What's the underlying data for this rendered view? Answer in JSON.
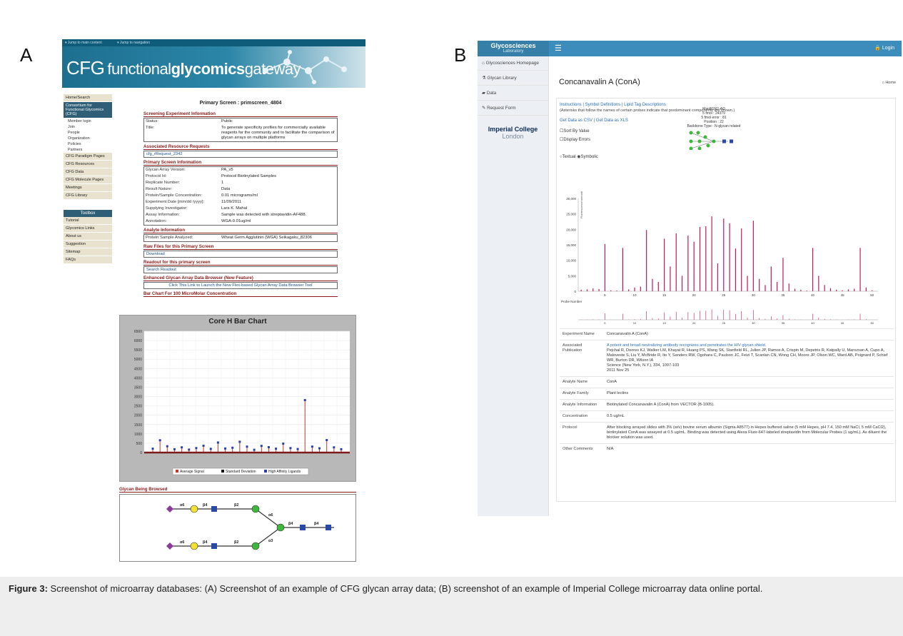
{
  "panel_labels": {
    "a": "A",
    "b": "B"
  },
  "cfg": {
    "skip_links": [
      "Jump to main content",
      "Jump to navigation"
    ],
    "logo_prefix": "CFG",
    "logo_text_1": "functional",
    "logo_text_2": "glycomics",
    "logo_text_3": "gateway",
    "nav": [
      {
        "label": "Home/Search",
        "dark": false
      },
      {
        "label": "Consortium for Functional Glycomics (CFG)",
        "dark": true
      }
    ],
    "subnav": [
      "Member login",
      "Join",
      "People",
      "Organization",
      "Policies",
      "Partners"
    ],
    "nav2": [
      "CFG Paradigm Pages",
      "CFG Resources",
      "CFG Data",
      "CFG Molecule Pages",
      "Meetings",
      "CFG Library"
    ],
    "toolbox_title": "Toolbox",
    "toolbox": [
      "Tutorial",
      "Glycomics Links",
      "About us",
      "Suggestion",
      "Sitemap",
      "FAQs"
    ],
    "page_title": "Primary Screen : primscreen_4804",
    "sec_screening": "Screening Experiment Information",
    "screening": [
      {
        "k": "Status:",
        "v": "Public"
      },
      {
        "k": "Title:",
        "v": "To generate specificity profiles for commercially available reagents for the community and to facilitate the comparison of glycan arrays on multiple platforms"
      }
    ],
    "sec_resource": "Associated Resource Requests",
    "resource": "cfg_rRequest_2342",
    "sec_primary": "Primary Screen Information",
    "primary": [
      {
        "k": "Glycan Array Version:",
        "v": "PA_v5",
        "link": false
      },
      {
        "k": "Protocol Id:",
        "v": "Protocol Biotinylated Samples",
        "link": true
      },
      {
        "k": "Replicate Number:",
        "v": "1",
        "link": false
      },
      {
        "k": "Result Nature:",
        "v": "Data",
        "link": false
      },
      {
        "k": "Protein/Sample Concentration:",
        "v": "0.01 micrograms/ml",
        "link": false
      },
      {
        "k": "Experiment Date [mm/dd /yyyy]:",
        "v": "11/09/2011",
        "link": false
      },
      {
        "k": "Supplying Investigator:",
        "v": "Lara K. Mahal",
        "link": true
      },
      {
        "k": "Assay Information:",
        "v": "Sample was detected with streptavidin-AF488.",
        "link": false
      },
      {
        "k": "Annotation:",
        "v": "WGA-0.01ug/ml",
        "link": false
      }
    ],
    "sec_analyte": "Analyte Information",
    "analyte_k": "Protein Sample Analyzed:",
    "analyte_v": "Wheat Germ Agglutinin (WGA) Seikagaku_82306",
    "sec_raw": "Raw Files for this Primary Screen",
    "raw": "Download",
    "sec_readout": "Readout for this primary screen",
    "readout": "Search Readout",
    "sec_enhanced": "Enhanced Glycan Array Data Browser (New Feature)",
    "enhanced": "Click This Link to Launch the New Flex-based Glycan Array Data Browser Tool",
    "sec_bar": "Bar Chart For 100 MicroMolar Concentration",
    "sec_glycan": "Glycan Being Browsed",
    "glycan_links": [
      "α6",
      "β4",
      "β2",
      "α6",
      "β4",
      "β4",
      "α6",
      "β4",
      "β2",
      "α3"
    ]
  },
  "chart_data": [
    {
      "type": "bar",
      "title": "Core H Bar Chart",
      "ylim": [
        0,
        6500
      ],
      "yticks": [
        0,
        500,
        1000,
        1500,
        2000,
        2500,
        3000,
        3500,
        4000,
        4500,
        5000,
        5500,
        6000,
        6500
      ],
      "series": [
        {
          "name": "Average Signal",
          "values": [
            150,
            600,
            280,
            120,
            220,
            100,
            180,
            310,
            140,
            480,
            160,
            200,
            520,
            260,
            90,
            300,
            230,
            150,
            420,
            180,
            130,
            2750,
            260,
            170,
            610,
            220,
            120
          ]
        },
        {
          "name": "Standard Deviation"
        },
        {
          "name": "High Affinity Ligands"
        }
      ],
      "grid": true,
      "legend": "bottom"
    },
    {
      "type": "bar",
      "ylabel": "Fluorescence intensity",
      "xlabel": "Probe Number",
      "ylim": [
        0,
        30000
      ],
      "yticks": [
        "0",
        "5,000",
        "10,000",
        "15,000",
        "20,000",
        "25,000",
        "30,000"
      ],
      "xticks": [
        5,
        10,
        15,
        20,
        25,
        30,
        35,
        40,
        45,
        50
      ],
      "x": [
        1,
        2,
        3,
        4,
        5,
        6,
        7,
        8,
        9,
        10,
        11,
        12,
        13,
        14,
        15,
        16,
        17,
        18,
        19,
        20,
        21,
        22,
        23,
        24,
        25,
        26,
        27,
        28,
        29,
        30,
        31,
        32,
        33,
        34,
        35,
        36,
        37,
        38,
        39,
        40,
        41,
        42,
        43,
        44,
        45,
        46,
        47,
        48,
        49,
        50
      ],
      "values": [
        500,
        600,
        900,
        700,
        15300,
        300,
        200,
        14000,
        600,
        1200,
        1500,
        19800,
        4000,
        3000,
        17000,
        8000,
        18700,
        5000,
        18000,
        16000,
        20800,
        21000,
        24200,
        9000,
        23500,
        22000,
        13800,
        20300,
        5000,
        22800,
        4000,
        2000,
        8000,
        3000,
        10800,
        2500,
        800,
        500,
        200,
        14000,
        5000,
        2000,
        1000,
        500,
        300,
        600,
        800,
        14000,
        1200,
        300
      ],
      "grid": false
    }
  ],
  "imperial": {
    "brand_1": "Glycosciences",
    "brand_2": "Laboratory",
    "login": "Login",
    "side": [
      "Glycosciences Homepage",
      "Glycan Library",
      "Data",
      "Request Form"
    ],
    "imperial_1": "Imperial College",
    "imperial_2": "London",
    "title": "Concanavalin A (ConA)",
    "home": "Home",
    "links": "Instructions | Symbol Definitions | Lipid Tag Descriptions",
    "note": "(Asterisks that follow the names of certain probes indicate that predominant components are shown.)",
    "download": "Get Data as CSV | Get Data as XLS",
    "sort": "Sort By Value",
    "errors": "Display Errors",
    "textual": "Textual",
    "symbolic": "Symbolic",
    "probe_lines": [
      "Man8GN2-AO",
      "5 fmol : 24379",
      "5 fmol error : 81",
      "Position : 22",
      "Backbone Type : N-glycan related"
    ],
    "table": [
      {
        "k": "Experiment Name",
        "v": [
          "Concanavalin A (ConA)"
        ]
      },
      {
        "k": "Associated Publication",
        "v": [
          "A potent and broad neutralizing antibody recognizes and penetrates the HIV glycan shield.",
          "Pejchal R, Doores KJ, Walker LM, Khayat R, Huang PS, Wang SK, Stanfield RL, Julien JP, Ramos A, Crispin M, Depetris R, Katpally U, Marozsan A, Cupo A, Maloveste S, Liu Y, McBride R, Ito Y, Sanders RW, Ogohara C, Paulson JC, Feizi T, Scanlan CN, Wong CH, Moore JP, Olson WC, Ward AB, Poignard P, Schief WR, Burton DR, Wilson IA",
          "Science (New York, N.Y.), 334, 1097-103",
          "2011 Nov 25"
        ]
      },
      {
        "k": "Analyte Name",
        "v": [
          "ConA"
        ]
      },
      {
        "k": "Analyte Family",
        "v": [
          "Plant lectins"
        ]
      },
      {
        "k": "Analyte Information",
        "v": [
          "Biotinylated Concanavalin A (ConA) from VECTOR (B-1005)."
        ]
      },
      {
        "k": "Concentration",
        "v": [
          "0.5 ug/mL"
        ]
      },
      {
        "k": "Protocol",
        "v": [
          "After blocking arrayed slides with 3% (w/v) bovine serum albumin (Sigma A8577) in Hepes buffered saline (5 mM Hepes, pH 7.4, 150 mM NaCl, 5 mM CaCl2), biotinylated ConA was assayed at 0.5 ug/mL. Binding was detected using Alexa Fluor-647-labeled streptavidin from Molecular Probes (1 ug/mL). As diluent the blocker solution was used."
        ]
      },
      {
        "k": "Other Comments",
        "v": [
          "N/A"
        ]
      }
    ]
  },
  "caption": {
    "label": "Figure 3:",
    "text": " Screenshot of microarray databases: (A) Screenshot of an example of CFG glycan array data; (B) screenshot of an example of Imperial College microarray data online portal."
  },
  "colors": {
    "cfg_blue": "#1d6f8f",
    "cfg_red": "#8b1a1a",
    "gl_blue": "#3c8dbc",
    "bar_pink": "#c2185b"
  }
}
